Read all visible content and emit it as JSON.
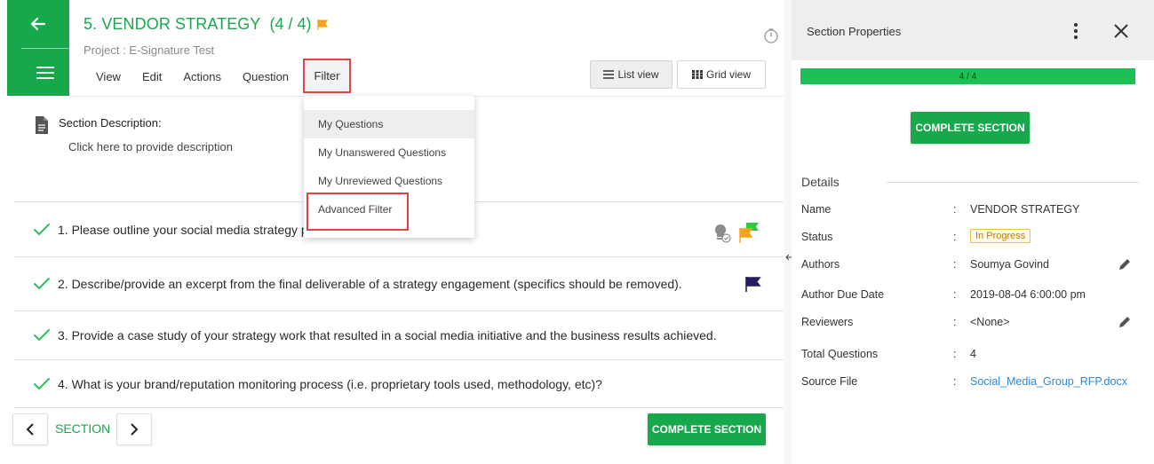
{
  "header": {
    "title": "5. VENDOR STRATEGY",
    "count": "(4 / 4)",
    "project": "Project : E-Signature Test"
  },
  "menu": {
    "items": [
      "View",
      "Edit",
      "Actions",
      "Question"
    ],
    "filter": "Filter"
  },
  "views": {
    "list": "List view",
    "grid": "Grid view"
  },
  "section": {
    "desc_label": "Section Description:",
    "desc_link": "Click here to provide description"
  },
  "filter_menu": {
    "items": [
      "My Questions",
      "My Unanswered Questions",
      "My Unreviewed Questions",
      "Advanced Filter"
    ]
  },
  "questions": [
    {
      "text": "1. Please outline your social media strategy p"
    },
    {
      "text": "2. Describe/provide an excerpt from the final deliverable of a strategy engagement (specifics should be removed)."
    },
    {
      "text": "3. Provide a case study of your strategy work that resulted in a social media initiative and the business results achieved."
    },
    {
      "text": "4. What is your brand/reputation monitoring process (i.e. proprietary tools used, methodology, etc)?"
    }
  ],
  "footer": {
    "section_label": "SECTION",
    "complete": "COMPLETE SECTION"
  },
  "panel": {
    "title": "Section Properties",
    "progress_text": "4 / 4",
    "progress_fraction": 1.0,
    "complete": "COMPLETE SECTION",
    "details_title": "Details",
    "colon": ":",
    "rows": {
      "name": {
        "label": "Name",
        "value": "VENDOR STRATEGY"
      },
      "status": {
        "label": "Status",
        "value": "In Progress"
      },
      "authors": {
        "label": "Authors",
        "value": "Soumya Govind"
      },
      "due": {
        "label": "Author Due Date",
        "value": "2019-08-04 6:00:00 pm"
      },
      "reviewers": {
        "label": "Reviewers",
        "value": "<None>"
      },
      "total": {
        "label": "Total Questions",
        "value": "4"
      },
      "source": {
        "label": "Source File",
        "value": "Social_Media_Group_RFP.docx"
      }
    }
  },
  "colors": {
    "brand_green": "#18a84c",
    "progress_green": "#1fbf57",
    "highlight_red": "#e04545",
    "flag_orange": "#f7a21b",
    "flag_green": "#2ecc40",
    "flag_purple": "#2a1a5e",
    "link_blue": "#2c88d9"
  }
}
